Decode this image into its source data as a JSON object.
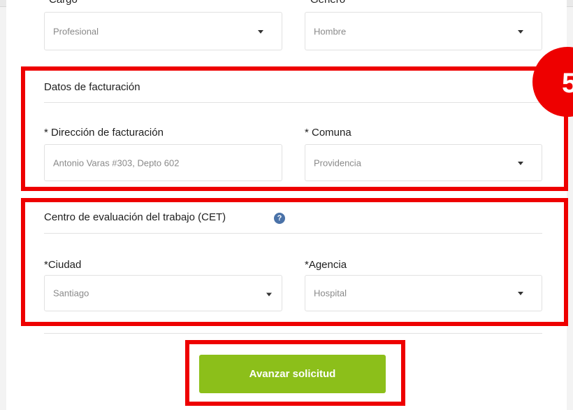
{
  "top_fields": {
    "left_label_partial": "Cargo",
    "right_label_partial": "Género",
    "cargo_value": "Profesional",
    "genero_value": "Hombre"
  },
  "step_badge": "5",
  "billing": {
    "title": "Datos de facturación",
    "address_label": "* Dirección de facturación",
    "address_value": "Antonio Varas #303, Depto 602",
    "comuna_label": "* Comuna",
    "comuna_value": "Providencia"
  },
  "cet": {
    "title": "Centro de evaluación del trabajo (CET)",
    "help_icon_glyph": "?",
    "ciudad_label": "*Ciudad",
    "ciudad_value": "Santiago",
    "agencia_label": "*Agencia",
    "agencia_value": "Hospital"
  },
  "submit_label": "Avanzar solicitud",
  "colors": {
    "highlight": "#ee0000",
    "button": "#8cbf1a",
    "help_icon": "#4a72a8"
  }
}
